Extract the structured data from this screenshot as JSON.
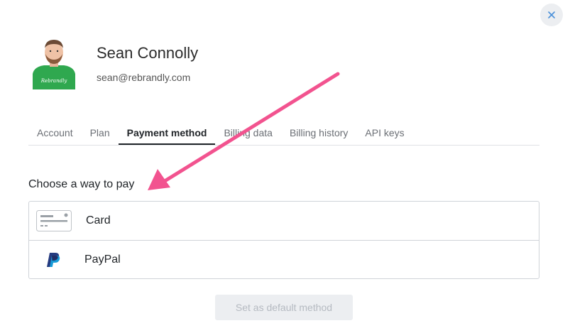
{
  "modal": {
    "close_icon": "close-icon"
  },
  "user": {
    "name": "Sean Connolly",
    "email": "sean@rebrandly.com",
    "shirt_text": "Rebrandly"
  },
  "tabs": [
    {
      "label": "Account",
      "active": false
    },
    {
      "label": "Plan",
      "active": false
    },
    {
      "label": "Payment method",
      "active": true
    },
    {
      "label": "Billing data",
      "active": false
    },
    {
      "label": "Billing history",
      "active": false
    },
    {
      "label": "API keys",
      "active": false
    }
  ],
  "payment": {
    "title": "Choose a way to pay",
    "options": [
      {
        "label": "Card",
        "icon": "credit-card-icon"
      },
      {
        "label": "PayPal",
        "icon": "paypal-icon"
      }
    ],
    "default_button": "Set as default method"
  },
  "colors": {
    "annotation_arrow": "#f2538f",
    "paypal_dark": "#253b80",
    "paypal_light": "#179bd7",
    "shirt_green": "#2fa84f"
  }
}
